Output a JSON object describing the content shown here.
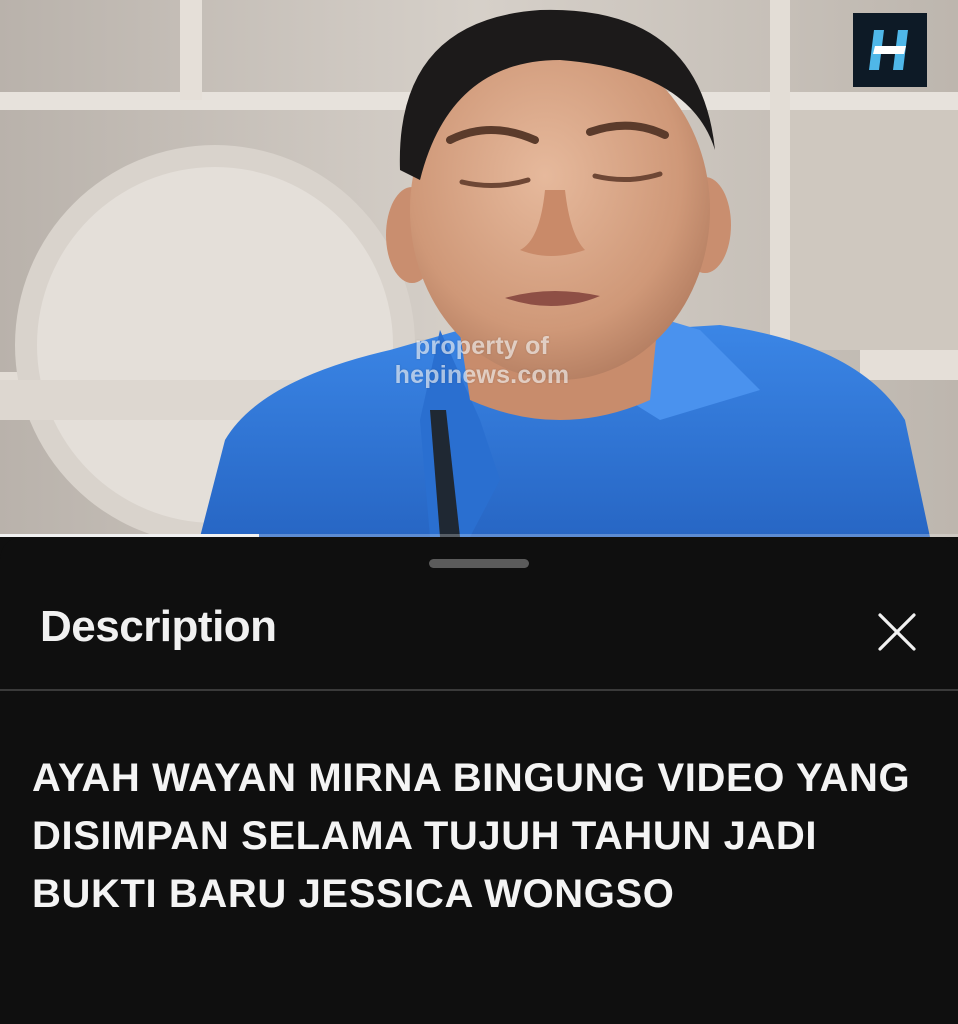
{
  "video": {
    "watermark_line1": "property of",
    "watermark_line2": "hepinews.com",
    "channel_logo_letter": "H",
    "progress_fraction": 0.27
  },
  "description_sheet": {
    "title": "Description",
    "close_icon": "close-icon",
    "video_title": "AYAH WAYAN MIRNA BINGUNG VIDEO YANG DISIMPAN SELAMA TUJUH TAHUN JADI BUKTI BARU JESSICA WONGSO"
  },
  "colors": {
    "sheet_background": "#0f0f0f",
    "text_primary": "#f1f1f1",
    "shirt_blue": "#2f78d8",
    "logo_accent": "#4fb7e8"
  }
}
